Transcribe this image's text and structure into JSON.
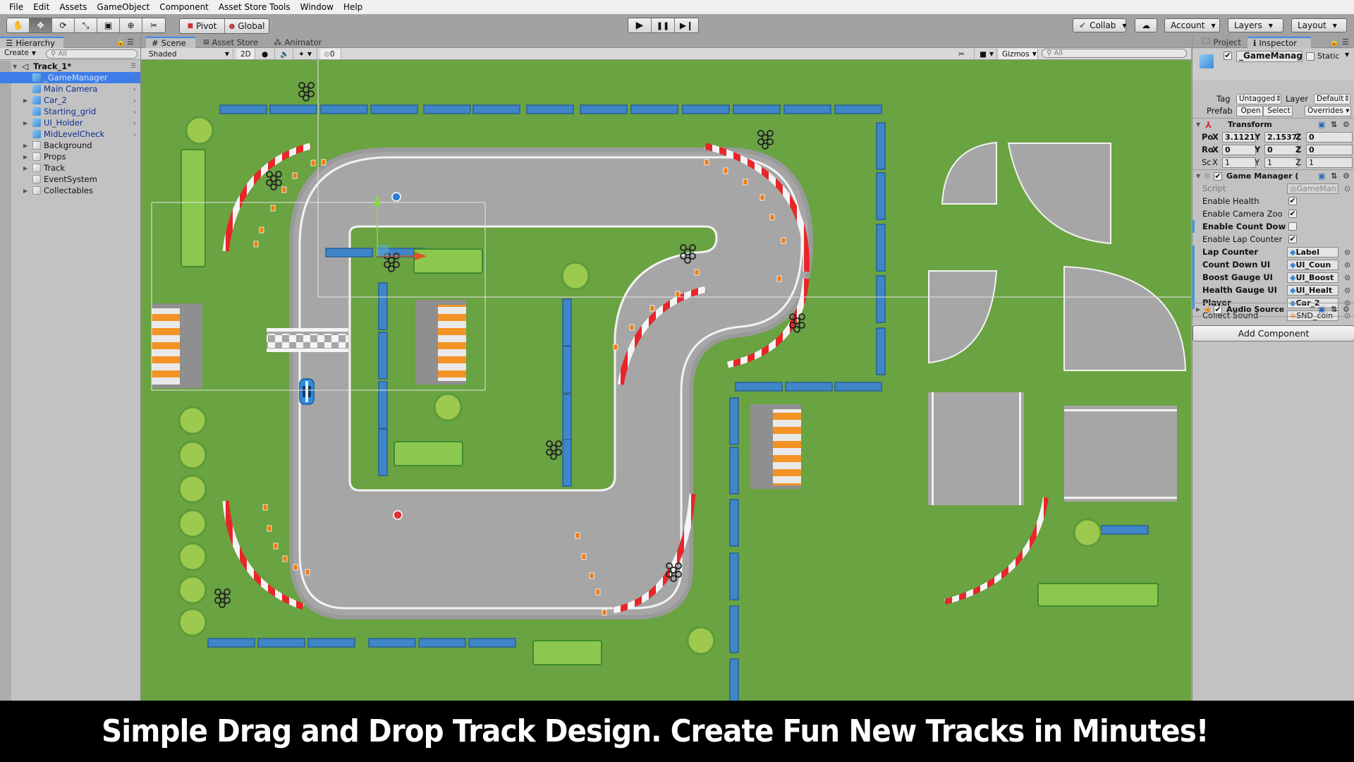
{
  "menu": [
    "File",
    "Edit",
    "Assets",
    "GameObject",
    "Component",
    "Asset Store Tools",
    "Window",
    "Help"
  ],
  "toolbar": {
    "tools": [
      {
        "name": "hand-tool",
        "glyph": "✋"
      },
      {
        "name": "move-tool",
        "glyph": "✥"
      },
      {
        "name": "rotate-tool",
        "glyph": "⟳"
      },
      {
        "name": "scale-tool",
        "glyph": "⤡"
      },
      {
        "name": "rect-tool",
        "glyph": "▣"
      },
      {
        "name": "transform-tool",
        "glyph": "⊕"
      },
      {
        "name": "custom-tool",
        "glyph": "✂"
      }
    ],
    "active_tool_index": 1,
    "pivot_label": "Pivot",
    "global_label": "Global",
    "play_glyph": "▶",
    "pause_glyph": "❚❚",
    "step_glyph": "▶❙",
    "collab_label": "Collab",
    "cloud_glyph": "☁",
    "account_label": "Account",
    "layers_label": "Layers",
    "layout_label": "Layout"
  },
  "hierarchy": {
    "tab_label": "Hierarchy",
    "create_label": "Create",
    "search_placeholder": "All",
    "scene_name": "Track_1*",
    "items": [
      {
        "label": "_GameManager",
        "type": "prefab",
        "expandable": false,
        "selected": true
      },
      {
        "label": "Main Camera",
        "type": "prefab",
        "expandable": false,
        "selected": false
      },
      {
        "label": "Car_2",
        "type": "prefab",
        "expandable": true,
        "selected": false
      },
      {
        "label": "Starting_grid",
        "type": "prefab",
        "expandable": false,
        "selected": false
      },
      {
        "label": "UI_Holder",
        "type": "prefab",
        "expandable": true,
        "selected": false
      },
      {
        "label": "MidLevelCheck",
        "type": "prefab",
        "expandable": false,
        "selected": false
      },
      {
        "label": "Background",
        "type": "object",
        "expandable": true,
        "selected": false
      },
      {
        "label": "Props",
        "type": "object",
        "expandable": true,
        "selected": false
      },
      {
        "label": "Track",
        "type": "object",
        "expandable": true,
        "selected": false
      },
      {
        "label": "EventSystem",
        "type": "object",
        "expandable": false,
        "selected": false
      },
      {
        "label": "Collectables",
        "type": "object",
        "expandable": true,
        "selected": false
      }
    ]
  },
  "scene": {
    "tabs": [
      {
        "label": "Scene",
        "glyph": "#",
        "active": true
      },
      {
        "label": "Asset Store",
        "glyph": "🛍",
        "active": false
      },
      {
        "label": "Animator",
        "glyph": "⁂",
        "active": false
      }
    ],
    "shading_mode": "Shaded",
    "mode_2d_label": "2D",
    "hidden_count": "0",
    "gizmos_label": "Gizmos",
    "search_placeholder": "All"
  },
  "inspector": {
    "tabs": [
      {
        "label": "Project",
        "glyph": "🗀",
        "active": false
      },
      {
        "label": "Inspector",
        "glyph": "ℹ",
        "active": true
      }
    ],
    "object_name": "_GameManag",
    "active": true,
    "static_label": "Static",
    "static": false,
    "tag_label": "Tag",
    "tag_value": "Untagged",
    "layer_label": "Layer",
    "layer_value": "Default",
    "prefab_label": "Prefab",
    "open_label": "Open",
    "select_label": "Select",
    "overrides_label": "Overrides",
    "transform": {
      "title": "Transform",
      "rows": [
        {
          "label": "Po",
          "bold": true,
          "x": "3.1121",
          "y": "2.1537",
          "z": "0"
        },
        {
          "label": "Ro",
          "bold": true,
          "x": "0",
          "y": "0",
          "z": "0"
        },
        {
          "label": "Sc",
          "bold": false,
          "x": "1",
          "y": "1",
          "z": "1"
        }
      ]
    },
    "game_manager": {
      "title": "Game Manager (",
      "script_label": "Script",
      "script_value": "GameMan",
      "bools": [
        {
          "label": "Enable Health",
          "value": true,
          "bold": false
        },
        {
          "label": "Enable Camera Zoo",
          "value": true,
          "bold": false
        },
        {
          "label": "Enable Count Dow",
          "value": false,
          "bold": true
        },
        {
          "label": "Enable Lap Counter",
          "value": true,
          "bold": false
        }
      ],
      "refs": [
        {
          "label": "Lap Counter",
          "value": "Label",
          "bold": true,
          "kind": "object"
        },
        {
          "label": "Count Down UI",
          "value": "UI_Coun",
          "bold": true,
          "kind": "object"
        },
        {
          "label": "Boost Gauge UI",
          "value": "UI_Boost",
          "bold": true,
          "kind": "object"
        },
        {
          "label": "Health Gauge UI",
          "value": "UI_Healt",
          "bold": true,
          "kind": "object"
        },
        {
          "label": "Player",
          "value": "Car_2",
          "bold": true,
          "kind": "object"
        },
        {
          "label": "Collect Sound",
          "value": "SND_coin",
          "bold": false,
          "kind": "audio"
        }
      ]
    },
    "audio_source_title": "Audio Source",
    "add_component_label": "Add Component"
  },
  "caption": "Simple Drag and Drop Track Design. Create Fun New Tracks in Minutes!",
  "colors": {
    "grass": "#6aa342",
    "asphalt": "#a6a6a6",
    "barrier_blue": "#3f86c8",
    "kerb_red": "#e8262a",
    "hedge": "#8cc850",
    "selection_blue": "#3e7de8",
    "cone_orange": "#ef7b12"
  }
}
